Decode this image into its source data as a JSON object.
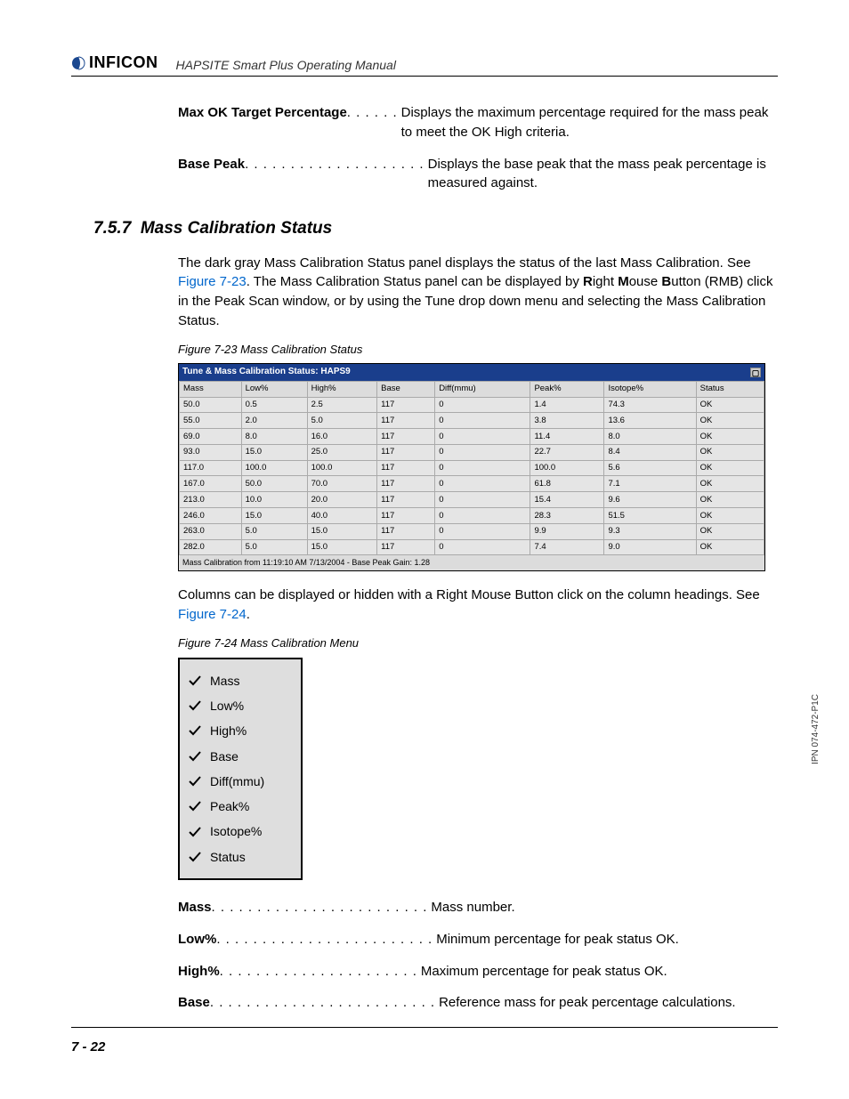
{
  "header": {
    "logo_text": "INFICON",
    "manual_title": "HAPSITE Smart Plus Operating Manual"
  },
  "defs_top": [
    {
      "term": "Max OK Target Percentage",
      "dots": " . . . . . . ",
      "desc": "Displays the maximum percentage required for the mass peak to meet the OK High criteria."
    },
    {
      "term": "Base Peak",
      "dots": " . . . . . . . . . . . . . . . . . . . . ",
      "desc": "Displays the base peak that the mass peak percentage is measured against."
    }
  ],
  "section": {
    "number": "7.5.7",
    "title": "Mass Calibration Status"
  },
  "para1_before": "The dark gray Mass Calibration Status panel displays the status of the last Mass Calibration. See ",
  "para1_link": "Figure 7-23",
  "para1_after": ". The Mass Calibration Status panel can be displayed by ",
  "para1_rmb": "Right Mouse Button",
  "para1_rmb_r": "R",
  "para1_rmb_ight": "ight ",
  "para1_rmb_m": "M",
  "para1_rmb_ouse": "ouse ",
  "para1_rmb_b": "B",
  "para1_rmb_utton": "utton",
  "para1_tail": " (RMB) click in the Peak Scan window, or by using the Tune drop down menu and selecting the Mass Calibration Status.",
  "fig723_caption": "Figure 7-23  Mass Calibration Status",
  "status_window": {
    "title": "Tune & Mass Calibration Status: HAPS9",
    "headers": [
      "Mass",
      "Low%",
      "High%",
      "Base",
      "Diff(mmu)",
      "Peak%",
      "Isotope%",
      "Status"
    ],
    "rows": [
      [
        "50.0",
        "0.5",
        "2.5",
        "117",
        "0",
        "1.4",
        "74.3",
        "OK"
      ],
      [
        "55.0",
        "2.0",
        "5.0",
        "117",
        "0",
        "3.8",
        "13.6",
        "OK"
      ],
      [
        "69.0",
        "8.0",
        "16.0",
        "117",
        "0",
        "11.4",
        "8.0",
        "OK"
      ],
      [
        "93.0",
        "15.0",
        "25.0",
        "117",
        "0",
        "22.7",
        "8.4",
        "OK"
      ],
      [
        "117.0",
        "100.0",
        "100.0",
        "117",
        "0",
        "100.0",
        "5.6",
        "OK"
      ],
      [
        "167.0",
        "50.0",
        "70.0",
        "117",
        "0",
        "61.8",
        "7.1",
        "OK"
      ],
      [
        "213.0",
        "10.0",
        "20.0",
        "117",
        "0",
        "15.4",
        "9.6",
        "OK"
      ],
      [
        "246.0",
        "15.0",
        "40.0",
        "117",
        "0",
        "28.3",
        "51.5",
        "OK"
      ],
      [
        "263.0",
        "5.0",
        "15.0",
        "117",
        "0",
        "9.9",
        "9.3",
        "OK"
      ],
      [
        "282.0",
        "5.0",
        "15.0",
        "117",
        "0",
        "7.4",
        "9.0",
        "OK"
      ]
    ],
    "footer": "Mass Calibration from 11:19:10 AM 7/13/2004 - Base Peak Gain: 1.28"
  },
  "para2_before": "Columns can be displayed or hidden with a Right Mouse Button click on the column headings. See ",
  "para2_link": "Figure 7-24",
  "para2_after": ".",
  "fig724_caption": "Figure 7-24  Mass Calibration Menu",
  "menu_items": [
    "Mass",
    "Low%",
    "High%",
    "Base",
    "Diff(mmu)",
    "Peak%",
    "Isotope%",
    "Status"
  ],
  "defs_bottom": [
    {
      "term": "Mass",
      "dots": "  . . . . . . . . . . . . . . . . . . . . . . . . ",
      "desc": "Mass number."
    },
    {
      "term": "Low%",
      "dots": ". . . . . . . . . . . . . . . . . . . . . . . . ",
      "desc": "Minimum percentage for peak status OK."
    },
    {
      "term": "High%",
      "dots": "  . . . . . . . . . . . . . . . . . . . . . . ",
      "desc": "Maximum percentage for peak status OK."
    },
    {
      "term": "Base",
      "dots": ". . . . . . . . . . . . . . . . . . . . . . . . . ",
      "desc": "Reference mass for peak percentage calculations."
    }
  ],
  "side_label": "IPN 074-472-P1C",
  "page_number": "7 - 22"
}
